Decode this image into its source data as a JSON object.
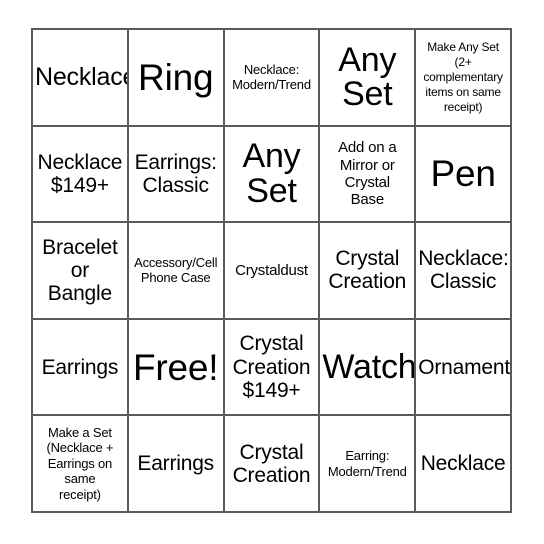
{
  "card": {
    "type": "bingo-card",
    "columns": 5,
    "rows": 5,
    "border_color": "#5a5a5a",
    "background_color": "#ffffff",
    "text_color": "#000000",
    "free_space_index": 11,
    "cells": [
      {
        "text": "Necklace",
        "size": "lg"
      },
      {
        "text": "Ring",
        "size": "xxl"
      },
      {
        "text": "Necklace:\nModern/Trend",
        "size": "xs"
      },
      {
        "text": "Any\nSet",
        "size": "xl"
      },
      {
        "text": "Make Any Set (2+ complementary items on same receipt)",
        "size": "xxs"
      },
      {
        "text": "Necklace\n$149+",
        "size": "md"
      },
      {
        "text": "Earrings:\nClassic",
        "size": "md"
      },
      {
        "text": "Any\nSet",
        "size": "xl"
      },
      {
        "text": "Add on a\nMirror or\nCrystal\nBase",
        "size": "sm"
      },
      {
        "text": "Pen",
        "size": "xxl"
      },
      {
        "text": "Bracelet\nor\nBangle",
        "size": "md"
      },
      {
        "text": "Accessory/Cell\nPhone Case",
        "size": "xs"
      },
      {
        "text": "Crystaldust",
        "size": "sm"
      },
      {
        "text": "Crystal\nCreation",
        "size": "md"
      },
      {
        "text": "Necklace:\nClassic",
        "size": "md"
      },
      {
        "text": "Earrings",
        "size": "md"
      },
      {
        "text": "Free!",
        "size": "xxl"
      },
      {
        "text": "Crystal\nCreation\n$149+",
        "size": "md"
      },
      {
        "text": "Watch",
        "size": "xl"
      },
      {
        "text": "Ornament",
        "size": "md"
      },
      {
        "text": "Make a Set\n(Necklace +\nEarrings on\nsame\nreceipt)",
        "size": "xs"
      },
      {
        "text": "Earrings",
        "size": "md"
      },
      {
        "text": "Crystal\nCreation",
        "size": "md"
      },
      {
        "text": "Earring:\nModern/Trend",
        "size": "xs"
      },
      {
        "text": "Necklace",
        "size": "md"
      }
    ]
  }
}
